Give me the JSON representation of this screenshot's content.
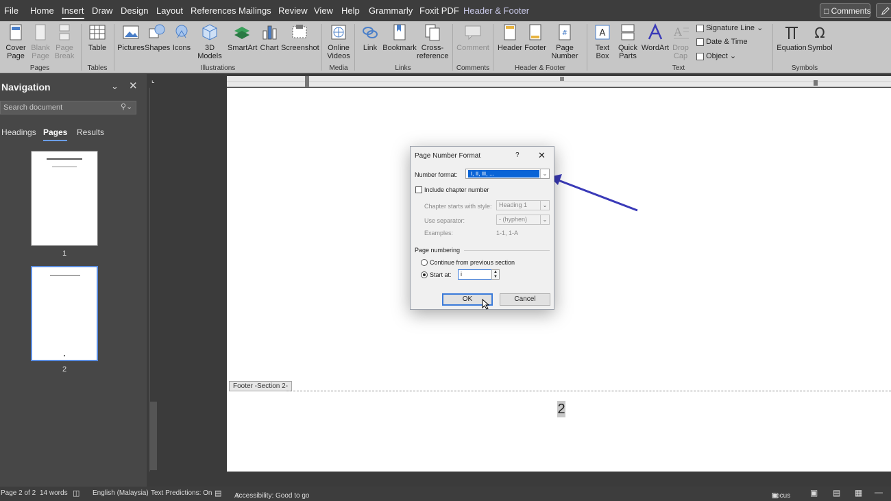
{
  "menubar": {
    "tabs": [
      "File",
      "Home",
      "Insert",
      "Draw",
      "Design",
      "Layout",
      "References",
      "Mailings",
      "Review",
      "View",
      "Help",
      "Grammarly",
      "Foxit PDF",
      "Header & Footer"
    ],
    "comments_label": "Comments"
  },
  "ribbon": {
    "cover_page": "Cover Page",
    "blank_page": "Blank Page",
    "page_break": "Page Break",
    "table": "Table",
    "pictures": "Pictures",
    "shapes": "Shapes",
    "icons": "Icons",
    "models_3d": "3D Models",
    "smartart": "SmartArt",
    "chart": "Chart",
    "screenshot": "Screenshot",
    "online_videos": "Online Videos",
    "link": "Link",
    "bookmark": "Bookmark",
    "cross_reference": "Cross-reference",
    "comment": "Comment",
    "header": "Header",
    "footer": "Footer",
    "page_number": "Page Number",
    "text_box": "Text Box",
    "quick_parts": "Quick Parts",
    "wordart": "WordArt",
    "drop_cap": "Drop Cap",
    "signature_line": "Signature Line",
    "date_time": "Date & Time",
    "object": "Object",
    "equation": "Equation",
    "symbol": "Symbol",
    "groups": {
      "pages": "Pages",
      "tables": "Tables",
      "illustrations": "Illustrations",
      "media": "Media",
      "links": "Links",
      "comments": "Comments",
      "header_footer": "Header & Footer",
      "text": "Text",
      "symbols": "Symbols"
    }
  },
  "navigation": {
    "title": "Navigation",
    "search_placeholder": "Search document",
    "tabs": [
      "Headings",
      "Pages",
      "Results"
    ],
    "thumbnails": [
      {
        "num": "1"
      },
      {
        "num": "2"
      }
    ]
  },
  "document": {
    "footer_label": "Footer -Section 2-",
    "page_number": "2"
  },
  "dialog": {
    "title": "Page Number Format",
    "help": "?",
    "number_format_label": "Number format:",
    "number_format_value": "i, ii, iii, ...",
    "include_chapter_label": "Include chapter number",
    "chapter_style_label": "Chapter starts with style:",
    "chapter_style_value": "Heading 1",
    "separator_label": "Use separator:",
    "separator_value": "-   (hyphen)",
    "examples_label": "Examples:",
    "examples_value": "1-1, 1-A",
    "page_numbering_label": "Page numbering",
    "continue_label": "Continue from previous section",
    "start_at_label": "Start at:",
    "start_at_value": "i",
    "ok_label": "OK",
    "cancel_label": "Cancel"
  },
  "statusbar": {
    "page": "Page 2 of 2",
    "words": "14 words",
    "language": "English (Malaysia)",
    "predictions": "Text Predictions: On",
    "accessibility": "Accessibility: Good to go",
    "focus": "Focus"
  },
  "colors": {
    "accent": "#3a3ab8",
    "selection": "#0a64d6"
  }
}
